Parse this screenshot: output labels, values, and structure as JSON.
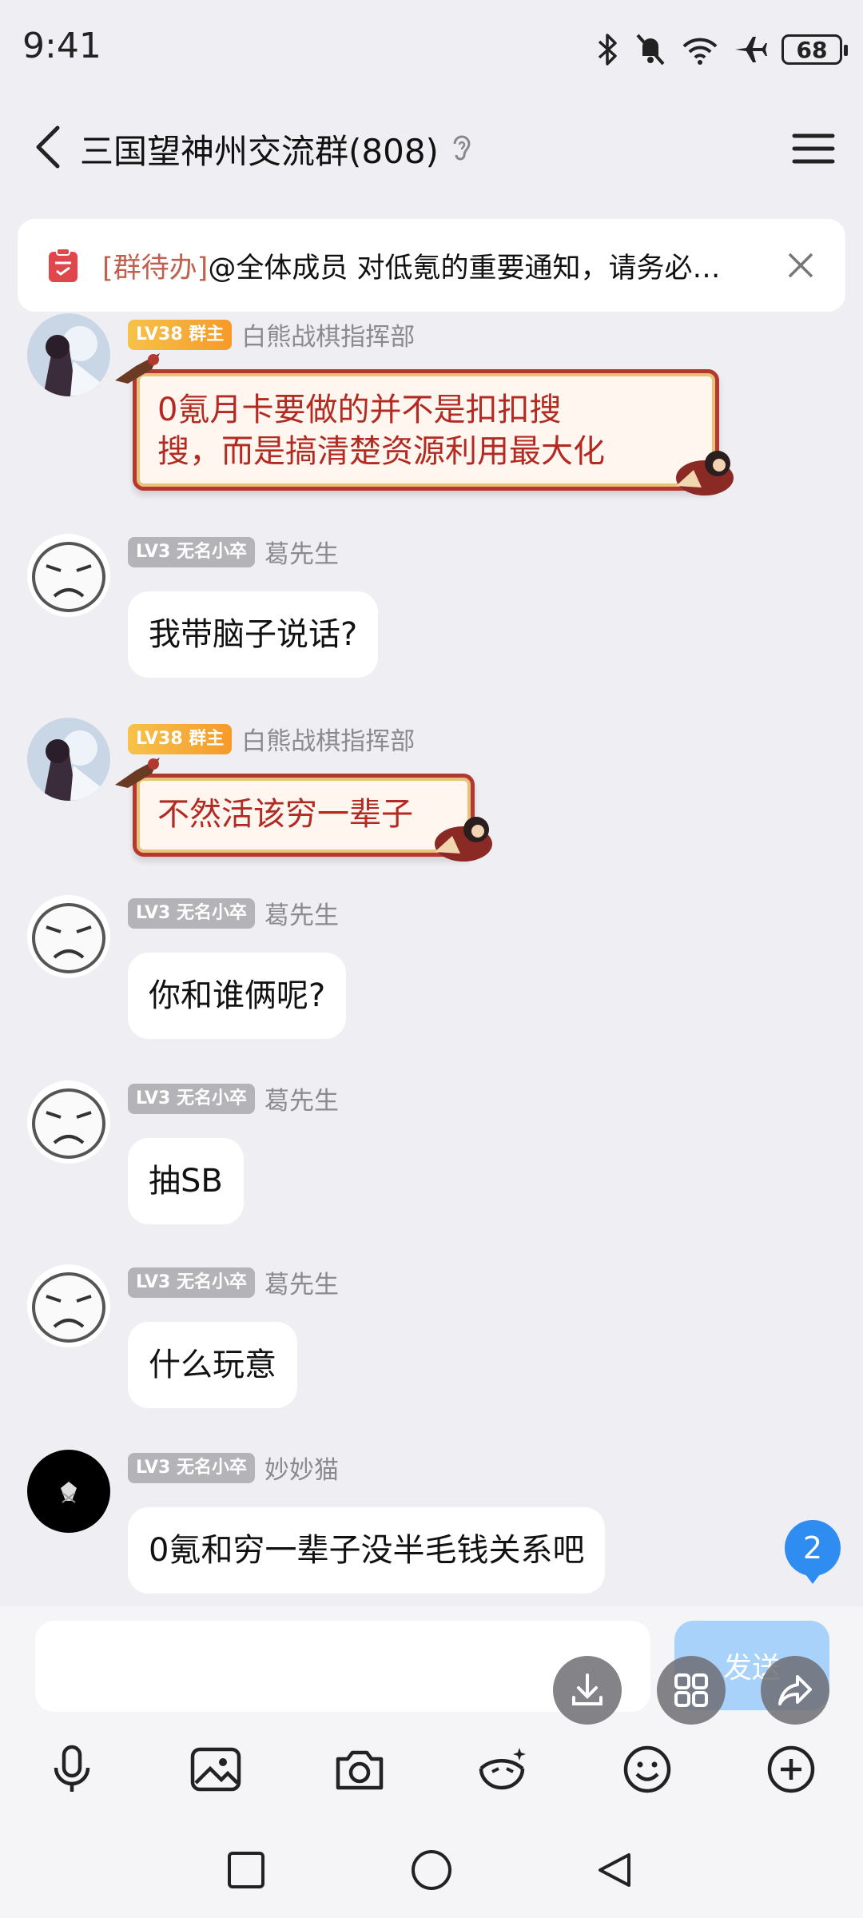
{
  "status": {
    "time": "9:41",
    "battery": "68"
  },
  "header": {
    "title": "三国望神州交流群(808)"
  },
  "notice": {
    "tag": "[群待办]",
    "text": "@全体成员  对低氪的重要通知，请务必…"
  },
  "messages": [
    {
      "badge": "LV38 群主",
      "sender": "白熊战棋指挥部",
      "line1": "0氪月卡要做的并不是扣扣搜",
      "line2": "搜，而是搞清楚资源利用最大化"
    },
    {
      "badge": "LV3 无名小卒",
      "sender": "葛先生",
      "text": "我带脑子说话?"
    },
    {
      "badge": "LV38 群主",
      "sender": "白熊战棋指挥部",
      "text": "不然活该穷一辈子"
    },
    {
      "badge": "LV3 无名小卒",
      "sender": "葛先生",
      "text": "你和谁俩呢?"
    },
    {
      "badge": "LV3 无名小卒",
      "sender": "葛先生",
      "text": "抽SB"
    },
    {
      "badge": "LV3 无名小卒",
      "sender": "葛先生",
      "text": "什么玩意"
    },
    {
      "badge": "LV3 无名小卒",
      "sender": "妙妙猫",
      "text": "0氪和穷一辈子没半毛钱关系吧"
    }
  ],
  "unread_count": "2",
  "input": {
    "send_label": "发送"
  },
  "colors": {
    "accent": "#2f8cf0",
    "owner_badge": "#f5a52a",
    "fancy_border": "#b3382f",
    "fancy_text": "#b22a22"
  }
}
